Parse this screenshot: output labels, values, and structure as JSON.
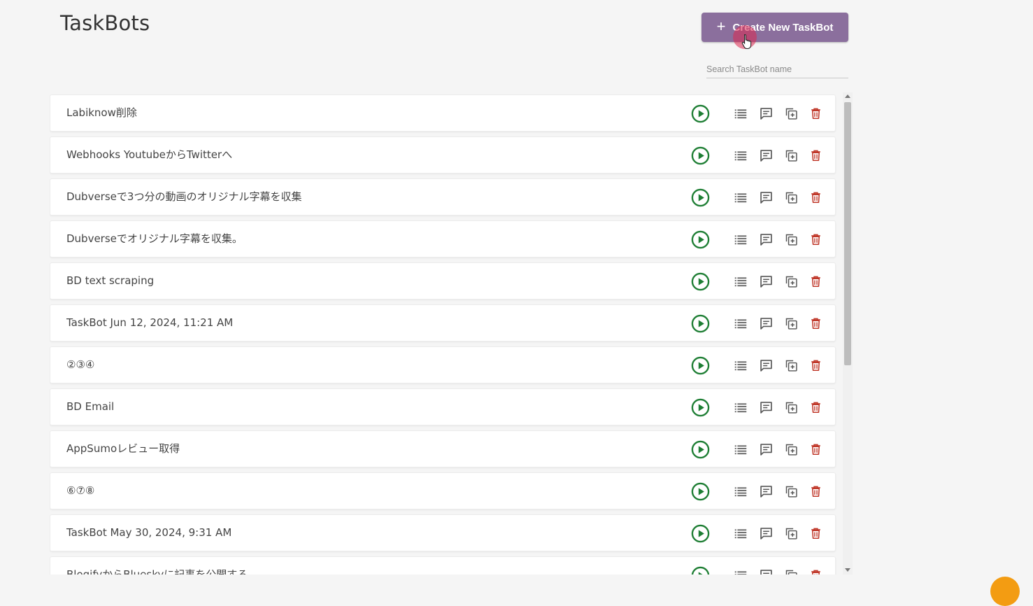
{
  "header": {
    "title": "TaskBots",
    "create_label": "Create New TaskBot",
    "search_placeholder": "Search TaskBot name"
  },
  "colors": {
    "accent": "#8b6f9d",
    "run": "#1e7e34",
    "delete": "#c0392b",
    "icon": "#555555"
  },
  "icons": {
    "run": "play-circle-icon",
    "list": "list-icon",
    "comment": "comment-icon",
    "copy": "duplicate-icon",
    "delete": "trash-icon",
    "create": "plus-icon"
  },
  "taskbots": [
    {
      "name": "Labiknow削除"
    },
    {
      "name": "Webhooks YoutubeからTwitterへ"
    },
    {
      "name": "Dubverseで3つ分の動画のオリジナル字幕を収集"
    },
    {
      "name": "Dubverseでオリジナル字幕を収集。"
    },
    {
      "name": "BD text scraping"
    },
    {
      "name": "TaskBot Jun 12, 2024, 11:21 AM"
    },
    {
      "name": "②③④"
    },
    {
      "name": "BD Email"
    },
    {
      "name": "AppSumoレビュー取得"
    },
    {
      "name": "⑥⑦⑧"
    },
    {
      "name": "TaskBot May 30, 2024, 9:31 AM"
    },
    {
      "name": "BlogifyからBlueskyに記事を公開する"
    }
  ]
}
